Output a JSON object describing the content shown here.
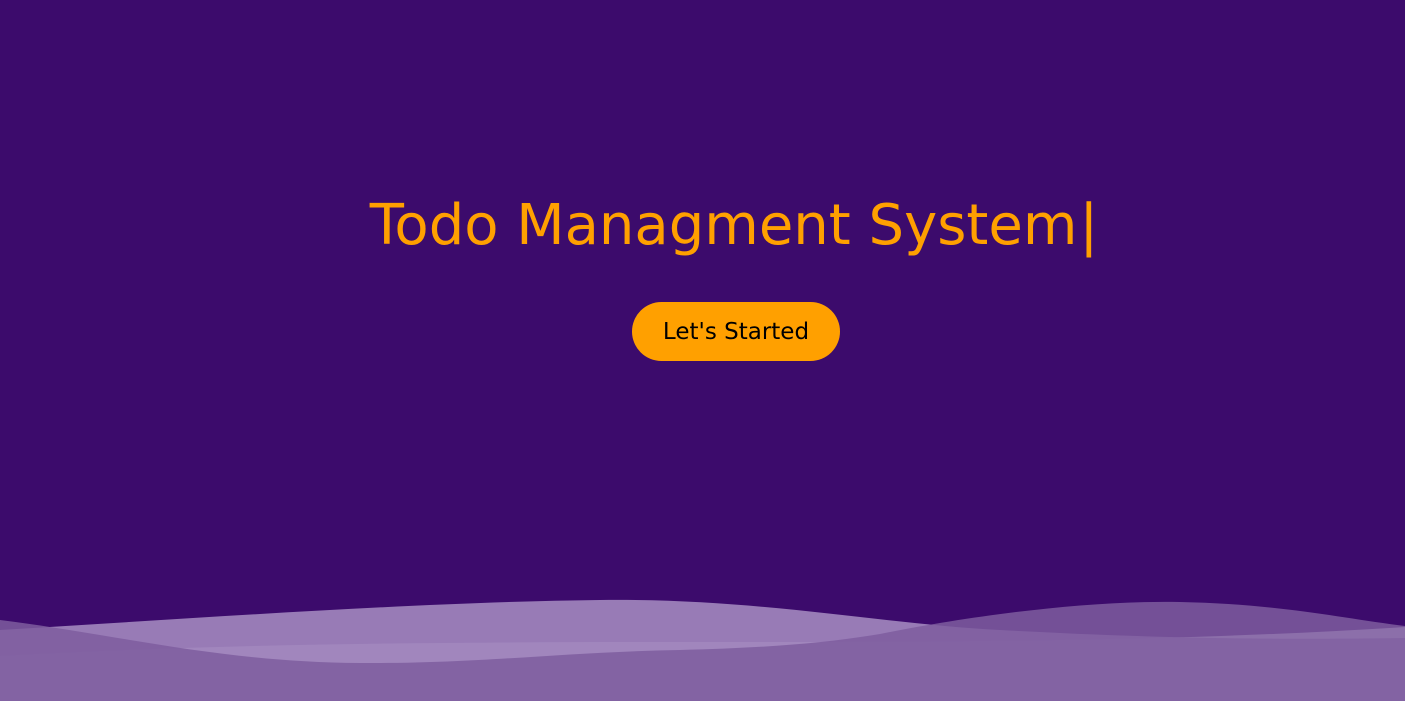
{
  "hero": {
    "title": "Todo Managment System",
    "cursor": "|",
    "button_label": "Let's Started"
  },
  "colors": {
    "background": "#3c0b6c",
    "accent": "#ffa000",
    "button_text": "#000000",
    "wave_light": "#ddd6ea",
    "wave_mid": "#9d82bb",
    "wave_dark": "#7e5d9f"
  }
}
